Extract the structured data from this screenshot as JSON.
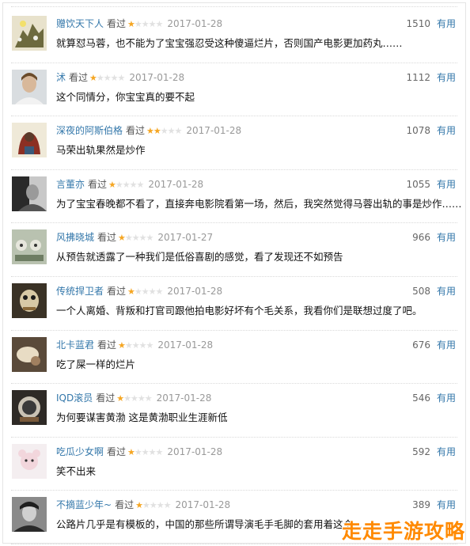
{
  "comments": [
    {
      "user": "赠饮天下人",
      "status": "看过",
      "rating": 1,
      "date": "2017-01-28",
      "votes": "1510",
      "useful": "有用",
      "text": "就算怼马蓉，也不能为了宝宝强忍受这种傻逼烂片，否则国产电影更加药丸……"
    },
    {
      "user": "沭",
      "status": "看过",
      "rating": 1,
      "date": "2017-01-28",
      "votes": "1112",
      "useful": "有用",
      "text": "这个同情分，你宝宝真的要不起"
    },
    {
      "user": "深夜的阿斯伯格",
      "status": "看过",
      "rating": 2,
      "date": "2017-01-28",
      "votes": "1078",
      "useful": "有用",
      "text": "马荣出轨果然是炒作"
    },
    {
      "user": "言董亦",
      "status": "看过",
      "rating": 1,
      "date": "2017-01-28",
      "votes": "1055",
      "useful": "有用",
      "text": "为了宝宝春晚都不看了，直接奔电影院看第一场，然后，我突然觉得马蓉出轨的事是炒作……"
    },
    {
      "user": "风拂晓城",
      "status": "看过",
      "rating": 1,
      "date": "2017-01-27",
      "votes": "966",
      "useful": "有用",
      "text": "从预告就透露了一种我们是低俗喜剧的感觉，看了发现还不如预告"
    },
    {
      "user": "传统捍卫者",
      "status": "看过",
      "rating": 1,
      "date": "2017-01-28",
      "votes": "508",
      "useful": "有用",
      "text": "一个人离婚、背叛和打官司跟他拍电影好坏有个毛关系，我看你们是联想过度了吧。"
    },
    {
      "user": "北卡蓝君",
      "status": "看过",
      "rating": 1,
      "date": "2017-01-28",
      "votes": "676",
      "useful": "有用",
      "text": "吃了屎一样的烂片"
    },
    {
      "user": "IQD滚员",
      "status": "看过",
      "rating": 1,
      "date": "2017-01-28",
      "votes": "546",
      "useful": "有用",
      "text": "为何要谋害黄渤 这是黄渤职业生涯新低"
    },
    {
      "user": "吃瓜少女啊",
      "status": "看过",
      "rating": 1,
      "date": "2017-01-28",
      "votes": "592",
      "useful": "有用",
      "text": "笑不出来"
    },
    {
      "user": "不摘蓝少年~",
      "status": "看过",
      "rating": 1,
      "date": "2017-01-28",
      "votes": "389",
      "useful": "有用",
      "text": "公路片几乎是有模板的，中国的那些所谓导演毛手毛脚的套用着这个……"
    }
  ],
  "watermark": "走走手游攻略",
  "colors": {
    "link": "#3377aa",
    "star": "#f5a623",
    "watermark": "#ff8a00"
  }
}
